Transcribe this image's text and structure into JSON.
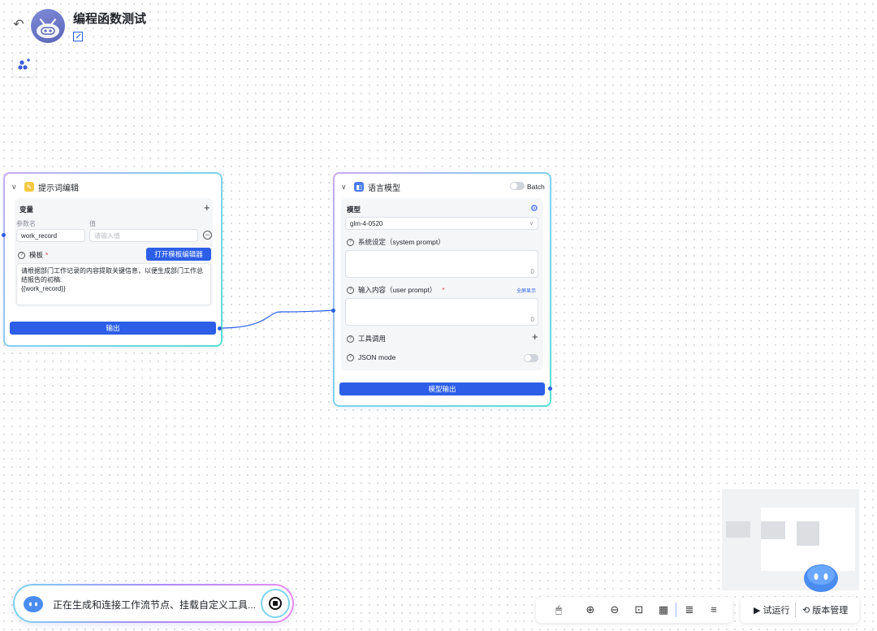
{
  "header": {
    "title": "编程函数测试"
  },
  "prompt_node": {
    "title": "提示词编辑",
    "variables_label": "变量",
    "param_name_header": "参数名",
    "value_header": "值",
    "param_name_value": "work_record",
    "value_placeholder": "请输入值",
    "template_label": "模板",
    "required_mark": "*",
    "open_editor_button": "打开模板编辑器",
    "template_line1": "请根据部门工作记录的内容提取关键信息，以便生成部门工作总",
    "template_line2": "结报告的初稿:",
    "template_line3": "{{work_record}}",
    "output_button": "输出"
  },
  "llm_node": {
    "title": "语言模型",
    "batch_label": "Batch",
    "model_label": "模型",
    "model_value": "glm-4-0520",
    "system_prompt_label": "系统设定（system prompt）",
    "system_prompt_count": "0",
    "user_prompt_label": "输入内容（user prompt）",
    "required_mark": "*",
    "fullscreen_label": "全屏显示",
    "user_prompt_count": "0",
    "tools_label": "工具调用",
    "json_mode_label": "JSON mode",
    "output_button": "模型输出"
  },
  "status": {
    "text": "正在生成和连接工作流节点、挂载自定义工具..."
  },
  "run_bar": {
    "run_label": "试运行",
    "version_label": "版本管理"
  },
  "colors": {
    "accent": "#2c5ee8",
    "prompt_icon": "#f5c842",
    "llm_icon": "#4b7bec"
  }
}
